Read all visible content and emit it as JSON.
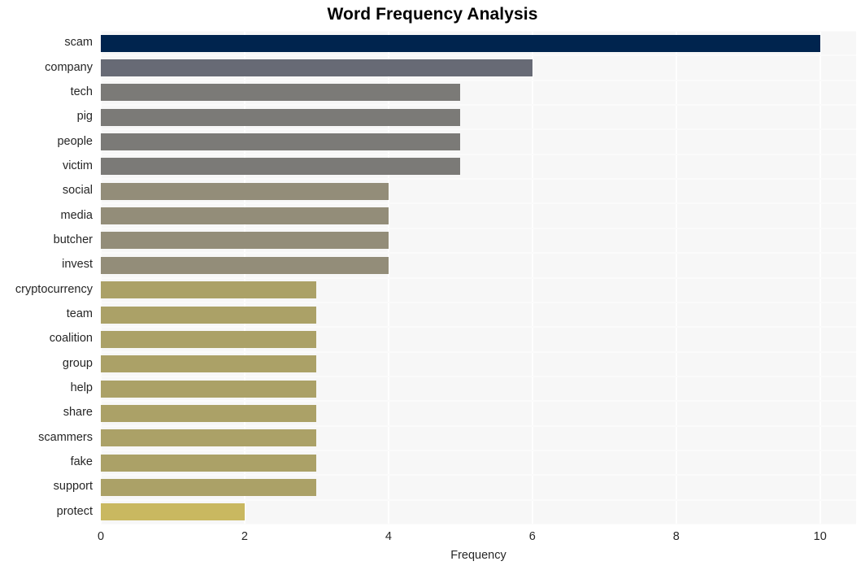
{
  "chart_data": {
    "type": "bar",
    "orientation": "horizontal",
    "title": "Word Frequency Analysis",
    "xlabel": "Frequency",
    "ylabel": "",
    "xlim": [
      0,
      10.5
    ],
    "xticks": [
      0,
      2,
      4,
      6,
      8,
      10
    ],
    "xtick_labels": [
      "0",
      "2",
      "4",
      "6",
      "8",
      "10"
    ],
    "grid": true,
    "legend": null,
    "categories": [
      "scam",
      "company",
      "tech",
      "pig",
      "people",
      "victim",
      "social",
      "media",
      "butcher",
      "invest",
      "cryptocurrency",
      "team",
      "coalition",
      "group",
      "help",
      "share",
      "scammers",
      "fake",
      "support",
      "protect"
    ],
    "values": [
      10,
      6,
      5,
      5,
      5,
      5,
      4,
      4,
      4,
      4,
      3,
      3,
      3,
      3,
      3,
      3,
      3,
      3,
      3,
      2
    ],
    "bar_colors": [
      "#00244e",
      "#676a75",
      "#7b7a77",
      "#7b7a77",
      "#7b7a77",
      "#7b7a77",
      "#938d79",
      "#938d79",
      "#938d79",
      "#938d79",
      "#aba167",
      "#aba167",
      "#aba167",
      "#aba167",
      "#aba167",
      "#aba167",
      "#aba167",
      "#aba167",
      "#aba167",
      "#c9b860"
    ],
    "plot_background": "#f7f7f7",
    "gridline_color": "#ffffff",
    "figure_background": "#ffffff"
  }
}
